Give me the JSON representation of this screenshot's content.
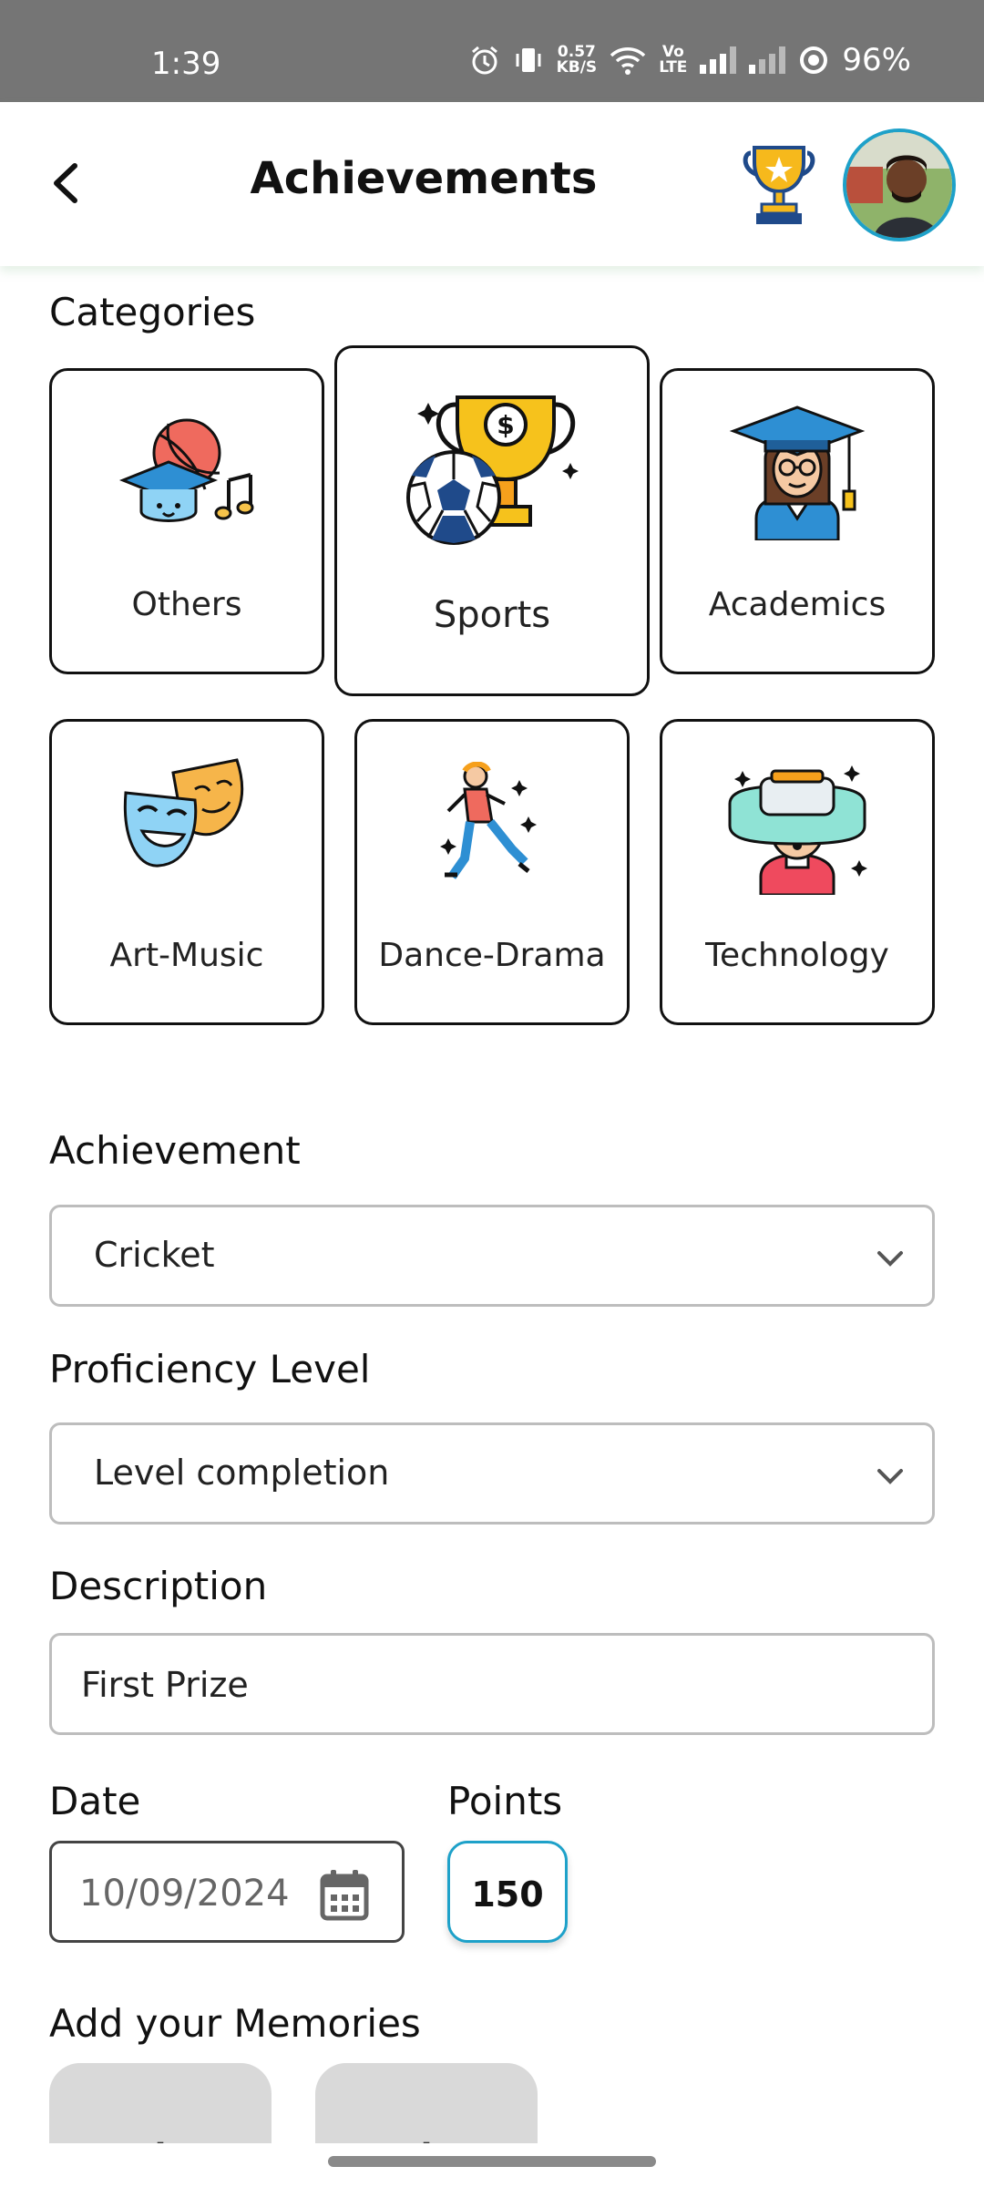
{
  "status_bar": {
    "time": "1:39",
    "net_speed_top": "0.57",
    "net_speed_bottom": "KB/S",
    "volte_top": "Vo",
    "volte_bottom": "LTE",
    "battery": "96%",
    "icons": [
      "alarm-icon",
      "vibrate-icon",
      "wifi-icon",
      "signal-icon",
      "battery-saver-icon"
    ]
  },
  "header": {
    "title": "Achievements",
    "back_icon": "chevron-left-icon",
    "trophy_icon": "trophy-star-icon",
    "avatar": "user-avatar"
  },
  "categories": {
    "label": "Categories",
    "items": [
      {
        "label": "Others",
        "icon": "graduation-cap-ball-music-icon"
      },
      {
        "label": "Sports",
        "icon": "trophy-football-icon",
        "selected": true
      },
      {
        "label": "Academics",
        "icon": "graduate-girl-icon"
      },
      {
        "label": "Art-Music",
        "icon": "theatre-masks-icon"
      },
      {
        "label": "Dance-Drama",
        "icon": "dancer-icon"
      },
      {
        "label": "Technology",
        "icon": "vr-headset-icon"
      }
    ]
  },
  "achievement": {
    "label": "Achievement",
    "value": "Cricket"
  },
  "proficiency": {
    "label": "Proficiency Level",
    "value": "Level completion"
  },
  "description": {
    "label": "Description",
    "value": "First Prize"
  },
  "date": {
    "label": "Date",
    "value": "10/09/2024"
  },
  "points": {
    "label": "Points",
    "value": "150"
  },
  "memories": {
    "label": "Add your Memories",
    "add_symbol": "+"
  },
  "colors": {
    "accent": "#1ea1c9",
    "status_bar": "#757575"
  }
}
